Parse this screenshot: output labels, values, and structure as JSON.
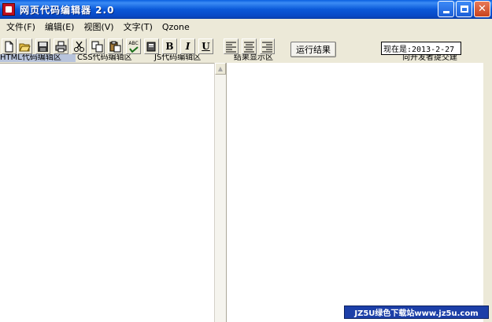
{
  "window": {
    "title": "网页代码编辑器 2.0",
    "minimize": "",
    "maximize": "",
    "close": "✕"
  },
  "menu": [
    {
      "label": "文件(F)"
    },
    {
      "label": "编辑(E)"
    },
    {
      "label": "视图(V)"
    },
    {
      "label": "文字(T)"
    },
    {
      "label": "Qzone"
    }
  ],
  "toolbar": {
    "icons": [
      "new-file-icon",
      "open-folder-icon",
      "save-disk-icon",
      "print-icon",
      "cut-scissors-icon",
      "copy-icon",
      "paste-icon",
      "spellcheck-icon",
      "find-icon"
    ],
    "bold": "B",
    "italic": "I",
    "underline": "U",
    "spellcheck_text": "ABC",
    "run_label": "运行结果",
    "date_text": "现在是:2013-2-27"
  },
  "labels": {
    "html": "HTML代码编辑区",
    "css": "CSS代码编辑区",
    "js": "JS代码编辑区",
    "result": "结果显示区",
    "feedback": "向开发者提交建"
  },
  "watermark": "JZ5U绿色下载站www.jz5u.com"
}
